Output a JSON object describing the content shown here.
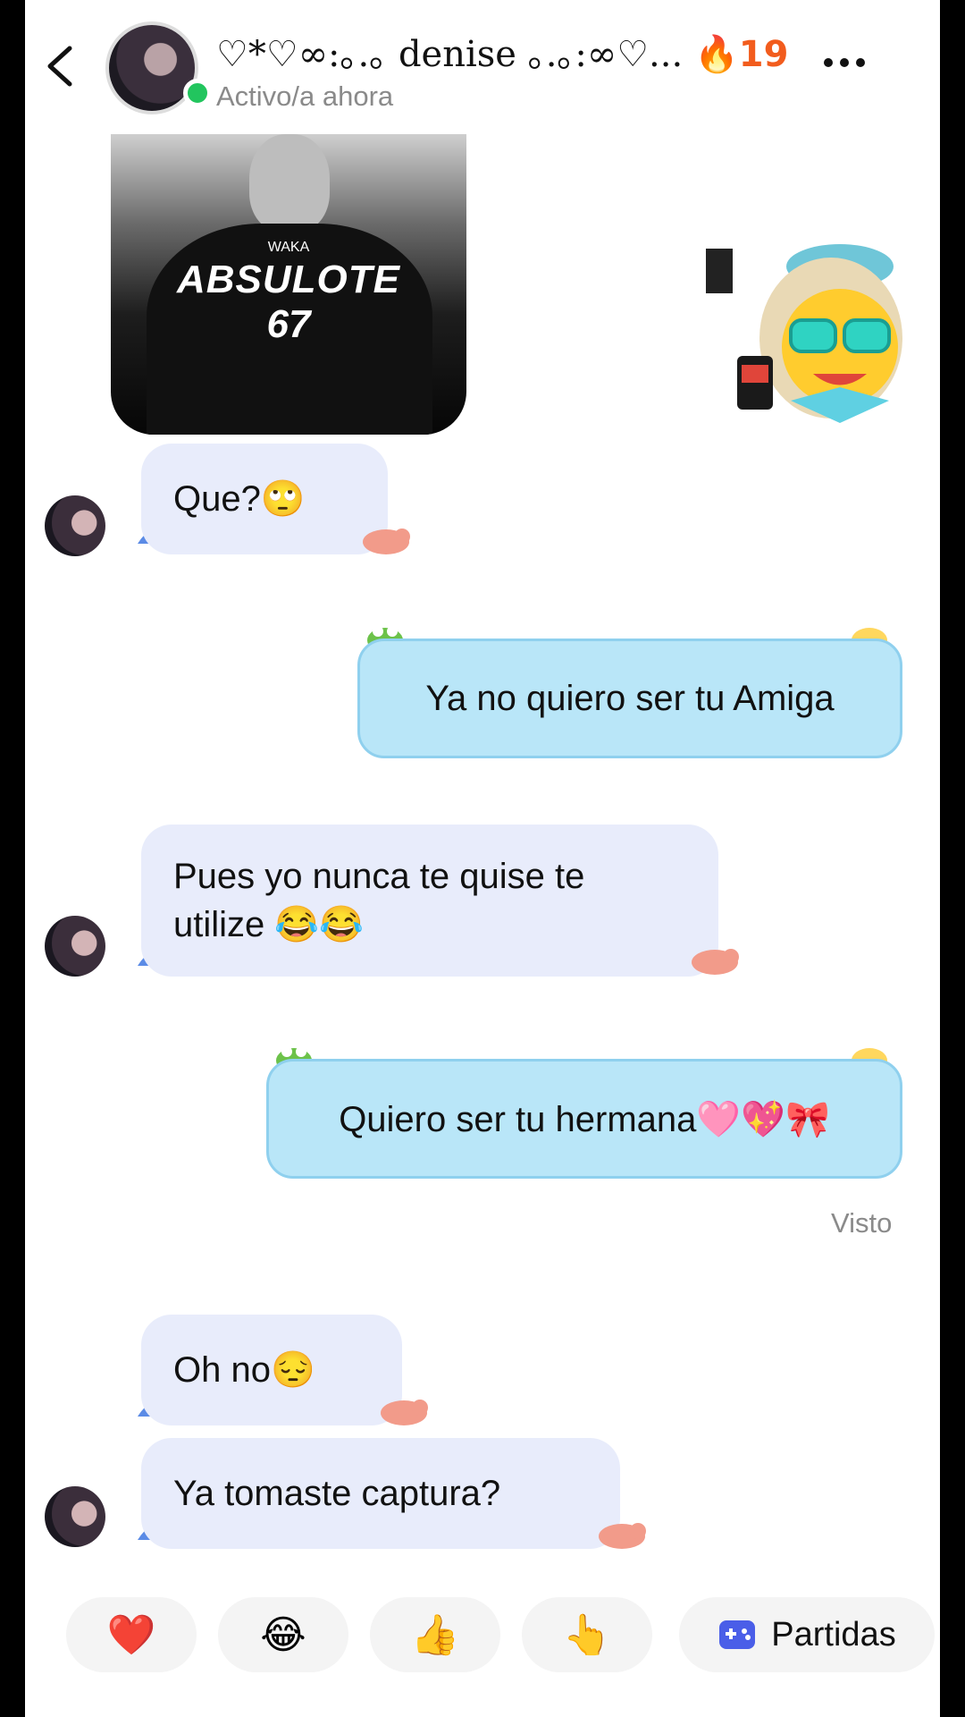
{
  "header": {
    "contact_name": "♡*♡∞:｡.｡ denise ｡.｡:∞♡...",
    "streak_icon": "🔥",
    "streak_count": "19",
    "status": "Activo/a ahora"
  },
  "media": {
    "photo_caption_small": "WAKA",
    "photo_caption_line1": "ABSULOTE",
    "photo_caption_line2": "67"
  },
  "messages": [
    {
      "sender": "them",
      "text": "Que?🙄"
    },
    {
      "sender": "me",
      "text": "Ya no quiero ser tu Amiga"
    },
    {
      "sender": "them",
      "text": "Pues yo nunca te quise te utilize 😂😂"
    },
    {
      "sender": "me",
      "text": "Quiero ser tu hermana🩷💖🎀"
    },
    {
      "sender": "them",
      "text": "Oh no😔"
    },
    {
      "sender": "them",
      "text": "Ya tomaste captura?"
    }
  ],
  "read_receipt": "Visto",
  "quick_reactions": [
    "❤️",
    "😂",
    "👍",
    "👆"
  ],
  "games_button": "Partidas",
  "colors": {
    "incoming_bubble": "#e8ecfb",
    "outgoing_bubble": "#b9e6f8",
    "streak": "#f25c1d",
    "online": "#22c55e"
  }
}
